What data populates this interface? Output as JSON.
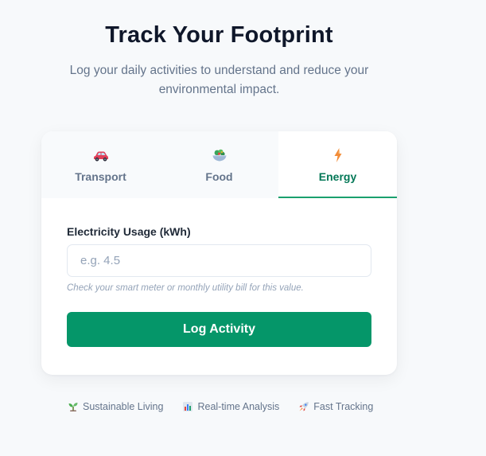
{
  "hero": {
    "title": "Track Your Footprint",
    "subtitle": "Log your daily activities to understand and reduce your environmental impact."
  },
  "tabs": [
    {
      "label": "Transport",
      "icon": "car-icon",
      "active": false
    },
    {
      "label": "Food",
      "icon": "salad-bowl-icon",
      "active": false
    },
    {
      "label": "Energy",
      "icon": "lightning-icon",
      "active": true
    }
  ],
  "form": {
    "field_label": "Electricity Usage (kWh)",
    "input_value": "",
    "input_placeholder": "e.g. 4.5",
    "hint": "Check your smart meter or monthly utility bill for this value.",
    "submit_label": "Log Activity"
  },
  "features": [
    {
      "label": "Sustainable Living",
      "icon": "seedling-icon"
    },
    {
      "label": "Real-time Analysis",
      "icon": "bar-chart-icon"
    },
    {
      "label": "Fast Tracking",
      "icon": "rocket-icon"
    }
  ],
  "colors": {
    "accent": "#059669",
    "active_tab_text": "#047857",
    "active_tab_underline": "#1aa06d",
    "muted_text": "#64748b",
    "title_text": "#0f172a"
  }
}
